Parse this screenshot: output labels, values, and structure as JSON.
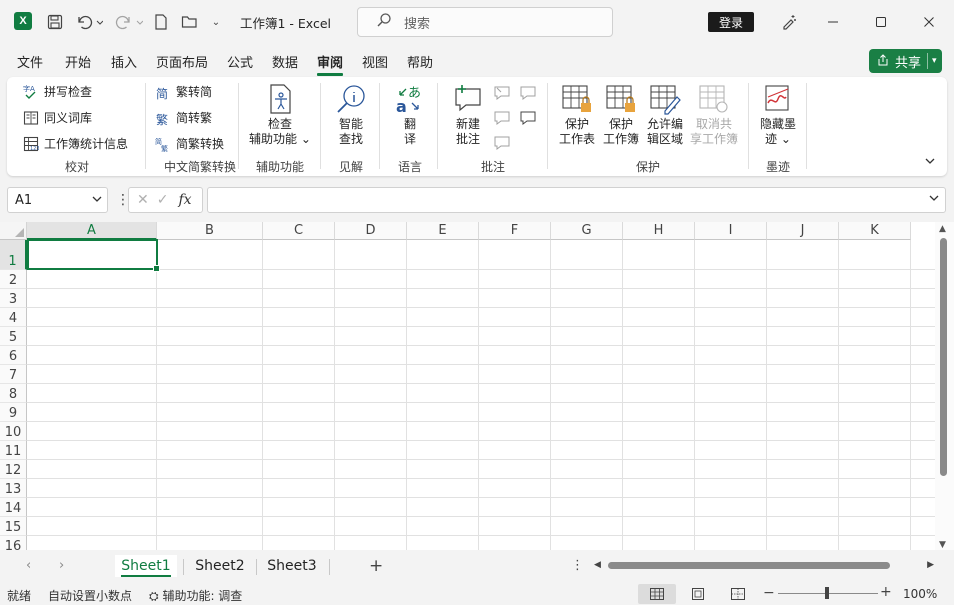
{
  "titlebar": {
    "app_icon": "excel-icon",
    "title": "工作簿1  -  Excel",
    "search_placeholder": "搜索",
    "login_label": "登录"
  },
  "menu": {
    "tabs": [
      "文件",
      "开始",
      "插入",
      "页面布局",
      "公式",
      "数据",
      "审阅",
      "视图",
      "帮助"
    ],
    "active": "审阅",
    "share_label": "共享"
  },
  "ribbon": {
    "proofing": {
      "label": "校对",
      "spelling": "拼写检查",
      "thesaurus": "同义词库",
      "stats": "工作簿统计信息"
    },
    "chinese": {
      "label": "中文简繁转换",
      "to_simplified": "繁转简",
      "to_traditional": "简转繁",
      "convert": "简繁转换"
    },
    "accessibility": {
      "label": "辅助功能",
      "check_line1": "检查",
      "check_line2": "辅助功能"
    },
    "insights": {
      "label": "见解",
      "smart_line1": "智能",
      "smart_line2": "查找"
    },
    "language": {
      "label": "语言",
      "translate_line1": "翻",
      "translate_line2": "译"
    },
    "comments": {
      "label": "批注",
      "new_line1": "新建",
      "new_line2": "批注"
    },
    "protect": {
      "label": "保护",
      "sheet_line1": "保护",
      "sheet_line2": "工作表",
      "book_line1": "保护",
      "book_line2": "工作簿",
      "ranges_line1": "允许编",
      "ranges_line2": "辑区域",
      "unshare_line1": "取消共",
      "unshare_line2": "享工作簿"
    },
    "ink": {
      "label": "墨迹",
      "hide_line1": "隐藏墨",
      "hide_line2": "迹"
    }
  },
  "formula_bar": {
    "name_box": "A1",
    "fx_label": "fx",
    "value": ""
  },
  "grid": {
    "columns": [
      "A",
      "B",
      "C",
      "D",
      "E",
      "F",
      "G",
      "H",
      "I",
      "J",
      "K"
    ],
    "rows": [
      "1",
      "2",
      "3",
      "4",
      "5",
      "6",
      "7",
      "8",
      "9",
      "10",
      "11",
      "12",
      "13",
      "14",
      "15",
      "16"
    ],
    "active_cell": "A1"
  },
  "sheets": {
    "tabs": [
      "Sheet1",
      "Sheet2",
      "Sheet3"
    ],
    "active": "Sheet1"
  },
  "status": {
    "ready": "就绪",
    "auto_decimal": "自动设置小数点",
    "accessibility": "辅助功能: 调查",
    "zoom": "100%"
  },
  "colors": {
    "accent": "#107c41",
    "share_bg": "#1a7f45"
  }
}
